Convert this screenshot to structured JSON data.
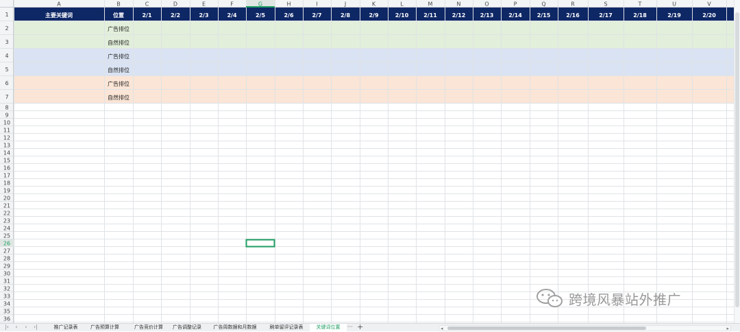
{
  "spreadsheet": {
    "columns": [
      "A",
      "B",
      "C",
      "D",
      "E",
      "F",
      "G",
      "H",
      "I",
      "J",
      "K",
      "L",
      "M",
      "N",
      "O",
      "P",
      "Q",
      "R",
      "S",
      "T",
      "U",
      "V"
    ],
    "row_count": 36,
    "selected_column": "G",
    "selected_row": 26,
    "header_row": [
      "主要关键词",
      "位置",
      "2/1",
      "2/2",
      "2/3",
      "2/4",
      "2/5",
      "2/6",
      "2/7",
      "2/8",
      "2/9",
      "2/10",
      "2/11",
      "2/12",
      "2/13",
      "2/14",
      "2/15",
      "2/16",
      "2/17",
      "2/18",
      "2/19",
      "2/20"
    ],
    "data_rows": [
      {
        "row": 2,
        "B": "广告排位",
        "fill": "#e2efda"
      },
      {
        "row": 3,
        "B": "自然排位",
        "fill": "#e2efda"
      },
      {
        "row": 4,
        "B": "广告排位",
        "fill": "#dae3f3"
      },
      {
        "row": 5,
        "B": "自然排位",
        "fill": "#dae3f3"
      },
      {
        "row": 6,
        "B": "广告排位",
        "fill": "#fbe5d6"
      },
      {
        "row": 7,
        "B": "自然排位",
        "fill": "#fbe5d6"
      }
    ],
    "colors": {
      "header_fill": "#0e2765",
      "header_text": "#ffffff",
      "selection": "#1e9d62",
      "gridline": "#dfe3e6",
      "heading_bg": "#f3f4f6",
      "heading_text": "#444444"
    }
  },
  "sheet_tabs": {
    "tabs": [
      "推广记录表",
      "广告预算计算",
      "广告竞价计算",
      "广告调整记录",
      "广告周数据和月数据",
      "刷单留评记录表",
      "关键词位置"
    ],
    "active_tab": "关键词位置",
    "more_label": "···",
    "add_label": "+"
  },
  "watermark": {
    "text": "跨境风暴站外推广",
    "icon": "wechat-icon"
  }
}
